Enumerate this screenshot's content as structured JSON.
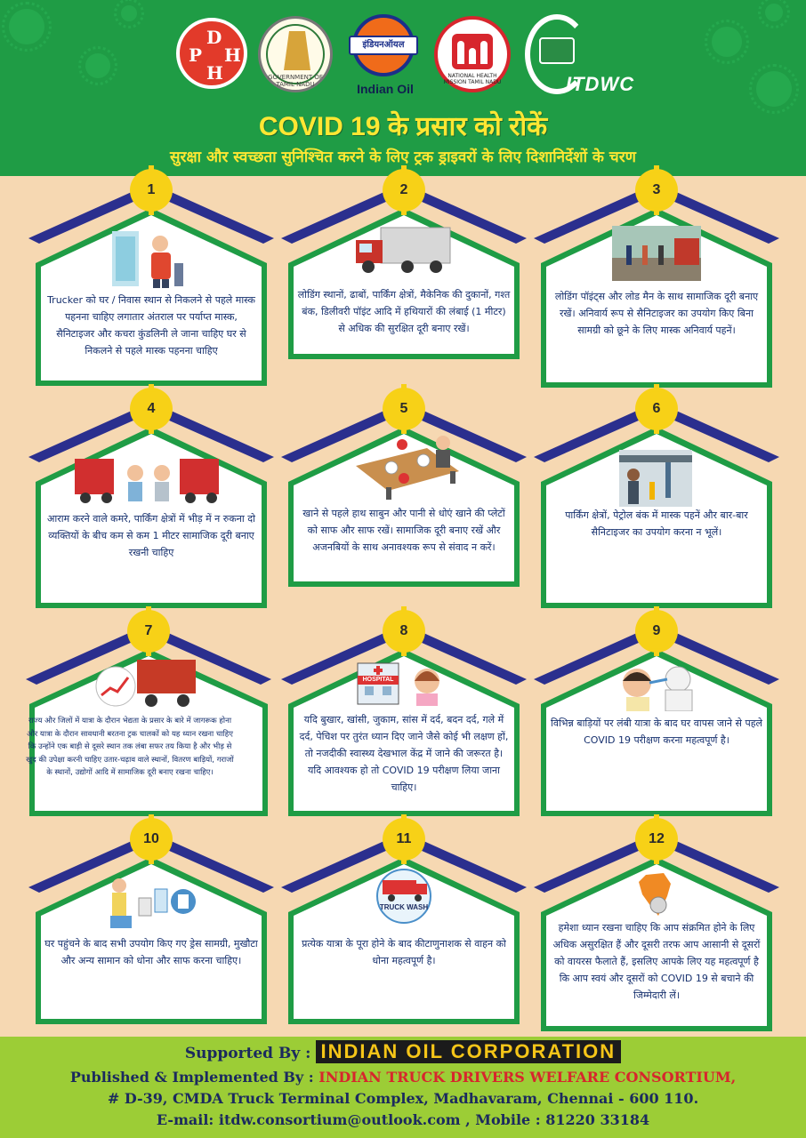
{
  "header": {
    "logos": {
      "dph": [
        "D",
        "P",
        "H",
        "H"
      ],
      "tn_caption": "GOVERNMENT OF TAMIL NADU",
      "ioc_band": "इंडियनऑयल",
      "ioc_name": "Indian Oil",
      "nhm_caption": "NATIONAL HEALTH MISSION TAMIL NADU",
      "itdw": "ITDWC"
    },
    "title": "COVID 19 के प्रसार को रोकें",
    "subtitle": "सुरक्षा और स्वच्छता सुनिश्चित करने के लिए ट्रक ड्राइवरों के लिए दिशानिर्देशों के चरण"
  },
  "cards": [
    {
      "num": "1",
      "text": "Trucker को घर / निवास स्थान से निकलने से पहले मास्क पहनना चाहिए लगातार अंतराल पर पर्याप्त मास्क, सैनिटाइजर और कचरा कुंडलिनी ले जाना चाहिए घर से निकलने से पहले मास्क पहनना चाहिए"
    },
    {
      "num": "2",
      "text": "लोडिंग स्थानों, ढाबों, पार्किंग क्षेत्रों, मैकेनिक की दुकानों, गश्त बंक, डिलीवरी पॉइंट आदि में हथियारों की लंबाई (1 मीटर) से अधिक की सुरक्षित दूरी बनाए रखें।"
    },
    {
      "num": "3",
      "text": "लोडिंग पॉइंट्स और लोड मैन के साथ सामाजिक दूरी बनाए रखें। अनिवार्य रूप से सैनिटाइजर का उपयोग किए बिना सामग्री को छूने के लिए मास्क अनिवार्य पहनें।"
    },
    {
      "num": "4",
      "text": "आराम करने वाले कमरे, पार्किंग क्षेत्रों में भीड़ में न रुकना दो व्यक्तियों के बीच कम से कम 1 मीटर सामाजिक दूरी बनाए रखनी चाहिए"
    },
    {
      "num": "5",
      "text": "खाने से पहले हाथ साबुन और पानी से धोएं खाने की प्लेटों को साफ और साफ रखें। सामाजिक दूरी बनाए रखें और अजनबियों के साथ अनावश्यक रूप से संवाद न करें।"
    },
    {
      "num": "6",
      "text": "पार्किंग क्षेत्रों, पेट्रोल बंक में मास्क पहनें और बार-बार सैनिटाइजर का उपयोग करना न भूलें।"
    },
    {
      "num": "7",
      "text": "राज्य और जिलों में यात्रा के दौरान भेद्यता के प्रसार के बारे में जागरूक होना और यात्रा के दौरान सावधानी बरतना ट्रक चालकों को यह ध्यान रखना चाहिए कि उन्होंने एक बाड़ी से दूसरे स्थान तक लंबा सफर तय किया है और भीड़ से खुद की उपेक्षा करनी चाहिए उतार-चढ़ाव वाले स्थानों, वितरण बाड़ियों, गराजों के स्थानों, उद्योगों आदि में सामाजिक दूरी बनाए रखना चाहिए।"
    },
    {
      "num": "8",
      "text": "यदि बुखार, खांसी, जुकाम, सांस में दर्द, बदन दर्द, गले में दर्द, पेचिश पर तुरंत ध्यान दिए जाने जैसे कोई भी लक्षण हों, तो नजदीकी स्वास्थ्य देखभाल केंद्र में जाने की जरूरत है। यदि आवश्यक हो तो COVID 19 परीक्षण लिया जाना चाहिए।"
    },
    {
      "num": "9",
      "text": "विभिन्न बाड़ियों पर लंबी यात्रा के बाद घर वापस जाने से पहले COVID 19 परीक्षण करना महत्वपूर्ण है।"
    },
    {
      "num": "10",
      "text": "घर पहुंचने के बाद सभी उपयोग किए गए ड्रेस सामग्री, मुखौटा और अन्य सामान को धोना और साफ करना चाहिए।"
    },
    {
      "num": "11",
      "text": "प्रत्येक यात्रा के पूरा होने के बाद कीटाणुनाशक से वाहन को धोना महत्वपूर्ण है।"
    },
    {
      "num": "12",
      "text": "हमेशा ध्यान रखना चाहिए कि आप संक्रमित होने के लिए अधिक असुरक्षित हैं और दूसरी तरफ आप आसानी से दूसरों को वायरस फैलाते हैं, इसलिए आपके लिए यह महत्वपूर्ण है कि आप स्वयं और दूसरों को COVID 19 से बचाने की जिम्मेदारी लें।"
    }
  ],
  "illus_labels": {
    "hospital": "HOSPITAL",
    "truck_wash": "TRUCK WASH"
  },
  "footer": {
    "supported_label": "Supported By :",
    "supported_org": "INDIAN OIL CORPORATION",
    "published_label": "Published & Implemented By :",
    "published_org": "INDIAN TRUCK DRIVERS WELFARE CONSORTIUM,",
    "address": "# D-39, CMDA Truck Terminal Complex, Madhavaram, Chennai - 600 110.",
    "contact": "E-mail: itdw.consortium@outlook.com , Mobile : 81220 33184"
  },
  "colors": {
    "green": "#1f9c45",
    "navy": "#2b2f8e",
    "yellow": "#ffe733",
    "peach": "#f6d8b2",
    "lime": "#9ccd36"
  }
}
